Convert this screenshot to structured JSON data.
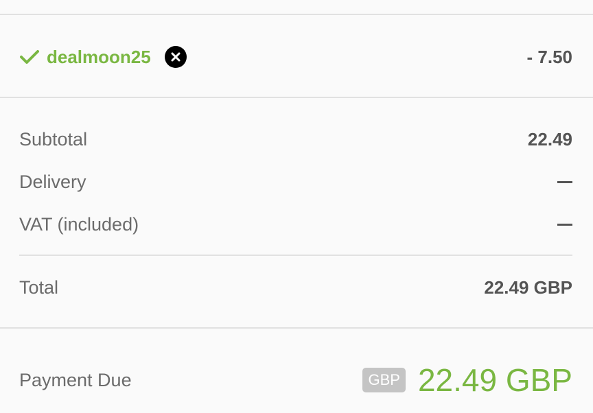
{
  "discount": {
    "code": "dealmoon25",
    "amount": "- 7.50"
  },
  "summary": {
    "subtotal_label": "Subtotal",
    "subtotal_value": "22.49",
    "delivery_label": "Delivery",
    "vat_label": "VAT (included)"
  },
  "total": {
    "label": "Total",
    "value": "22.49 GBP"
  },
  "payment_due": {
    "label": "Payment Due",
    "currency": "GBP",
    "amount": "22.49 GBP"
  },
  "colors": {
    "accent_green": "#7ab742",
    "text": "#545454",
    "divider": "#e1e1e1",
    "badge": "#c4c4c4"
  },
  "icons": {
    "applied": "check-icon",
    "remove": "close-circle-icon"
  }
}
